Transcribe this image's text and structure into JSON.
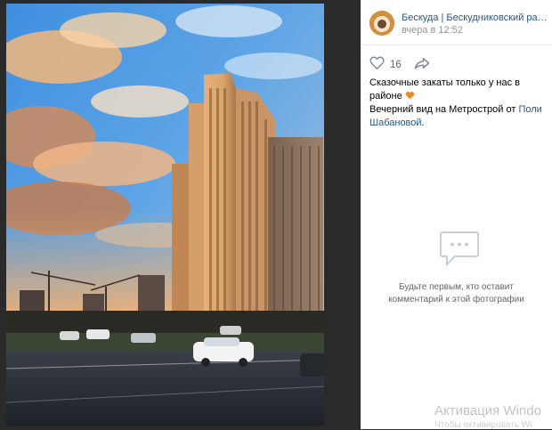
{
  "post": {
    "author": "Бескуда | Бескудниковский район ...",
    "time": "вчера в 12:52",
    "likes": "16",
    "text_line1": "Сказочные закаты только у нас в районе",
    "text_line2": "Вечерний вид на Метрострой от",
    "text_link": "Поли Шабановой",
    "text_end": "."
  },
  "comments": {
    "empty_text": "Будьте первым, кто оставит комментарий к этой фотографии"
  },
  "watermark": {
    "title": "Активация Windo",
    "subtitle": "Чтобы активировать Wi"
  },
  "icons": {
    "like": "heart-outline-icon",
    "share": "share-arrow-icon",
    "comment": "comment-bubble-icon",
    "emoji": "orange-heart-emoji"
  },
  "colors": {
    "link": "#2a5885",
    "viewer_bg": "#2a2a2b"
  }
}
